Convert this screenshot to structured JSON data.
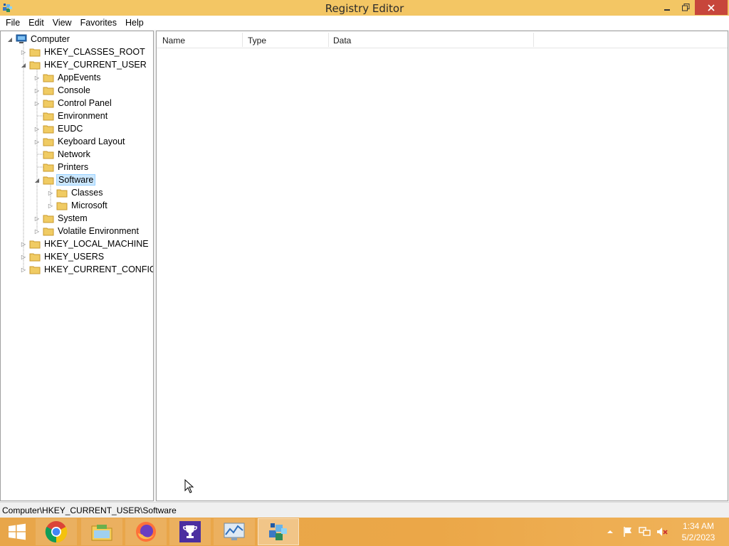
{
  "window": {
    "title": "Registry Editor",
    "menu": [
      "File",
      "Edit",
      "View",
      "Favorites",
      "Help"
    ]
  },
  "tree": {
    "computer": "Computer",
    "hkcr": "HKEY_CLASSES_ROOT",
    "hkcu": "HKEY_CURRENT_USER",
    "hkcu_children": {
      "appevents": "AppEvents",
      "console": "Console",
      "control_panel": "Control Panel",
      "environment": "Environment",
      "eudc": "EUDC",
      "keyboard_layout": "Keyboard Layout",
      "network": "Network",
      "printers": "Printers",
      "software": "Software",
      "software_children": {
        "classes": "Classes",
        "microsoft": "Microsoft"
      },
      "system": "System",
      "volatile_environment": "Volatile Environment"
    },
    "hklm": "HKEY_LOCAL_MACHINE",
    "hku": "HKEY_USERS",
    "hkcc": "HKEY_CURRENT_CONFIG"
  },
  "list": {
    "columns": [
      "Name",
      "Type",
      "Data"
    ]
  },
  "status": {
    "path": "Computer\\HKEY_CURRENT_USER\\Software"
  },
  "taskbar": {
    "apps": [
      "start-icon",
      "chrome-icon",
      "file-explorer-icon",
      "firefox-icon",
      "trophy-icon",
      "resource-monitor-icon",
      "registry-editor-icon"
    ],
    "time": "1:34 AM",
    "date": "5/2/2023"
  },
  "colors": {
    "titlebar": "#f3c664",
    "close_button": "#c7463b",
    "selection": "#cce8ff",
    "taskbar": "#eba748"
  }
}
